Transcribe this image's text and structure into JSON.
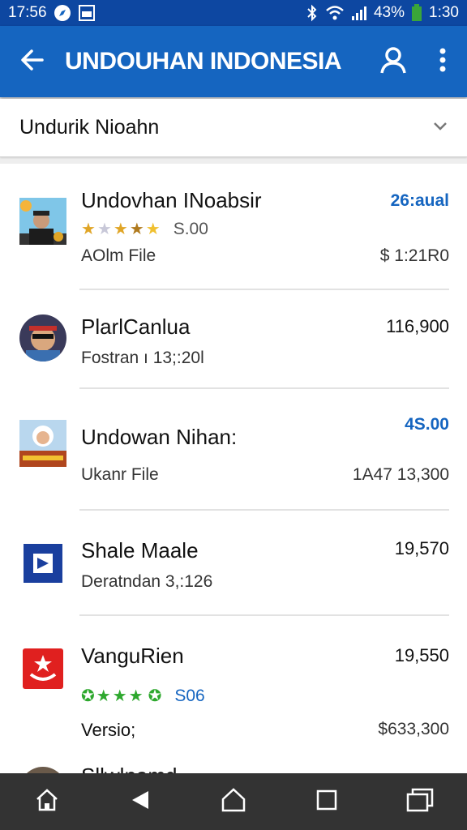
{
  "status_bar": {
    "time_left": "17:56",
    "battery_percent": "43%",
    "time_right": "1:30",
    "icons": [
      "compass-icon",
      "image-icon",
      "bluetooth-icon",
      "wifi-icon",
      "signal-icon",
      "battery-icon"
    ]
  },
  "app_bar": {
    "title": "UNDOUHAN INDONESIA",
    "icons": [
      "back-arrow-icon",
      "account-icon",
      "more-vert-icon"
    ]
  },
  "filter": {
    "label": "Undurik Nioahn",
    "icon": "chevron-down-icon"
  },
  "items": [
    {
      "title": "Undovhan INoabsir",
      "rating": 3.5,
      "rating_text": "S.00",
      "subtitle": "AOlm File",
      "right_top": "26:aual",
      "right_bottom": "$ 1:21R0",
      "star_color": "#e0a526"
    },
    {
      "title": "PlarlCanlua",
      "subtitle": "Fostran ı 13;:20l",
      "right_top": "116,900"
    },
    {
      "title": "Undowan Nihan:",
      "subtitle": "Ukanr File",
      "right_top": "4S.00",
      "right_bottom": "1A47 13,300"
    },
    {
      "title": "Shale Maale",
      "subtitle": "Deratndan 3,:126",
      "right_top": "19,570"
    },
    {
      "title": "VanguRien",
      "rating": 4,
      "rating_text": "S06",
      "subtitle": "Versio;",
      "right_top": "19,550",
      "right_bottom": "$633,300",
      "star_color": "#2ea82e"
    },
    {
      "title": "Sllwlnamd"
    }
  ],
  "nav_bar": {
    "icons": [
      "home-icon",
      "back-triangle-icon",
      "home-circle-icon",
      "recents-square-icon",
      "multiwindow-icon"
    ]
  },
  "colors": {
    "status_bar": "#0d47a1",
    "app_bar": "#1565c0",
    "accent_blue": "#1565c0",
    "nav_bar": "#333333"
  }
}
